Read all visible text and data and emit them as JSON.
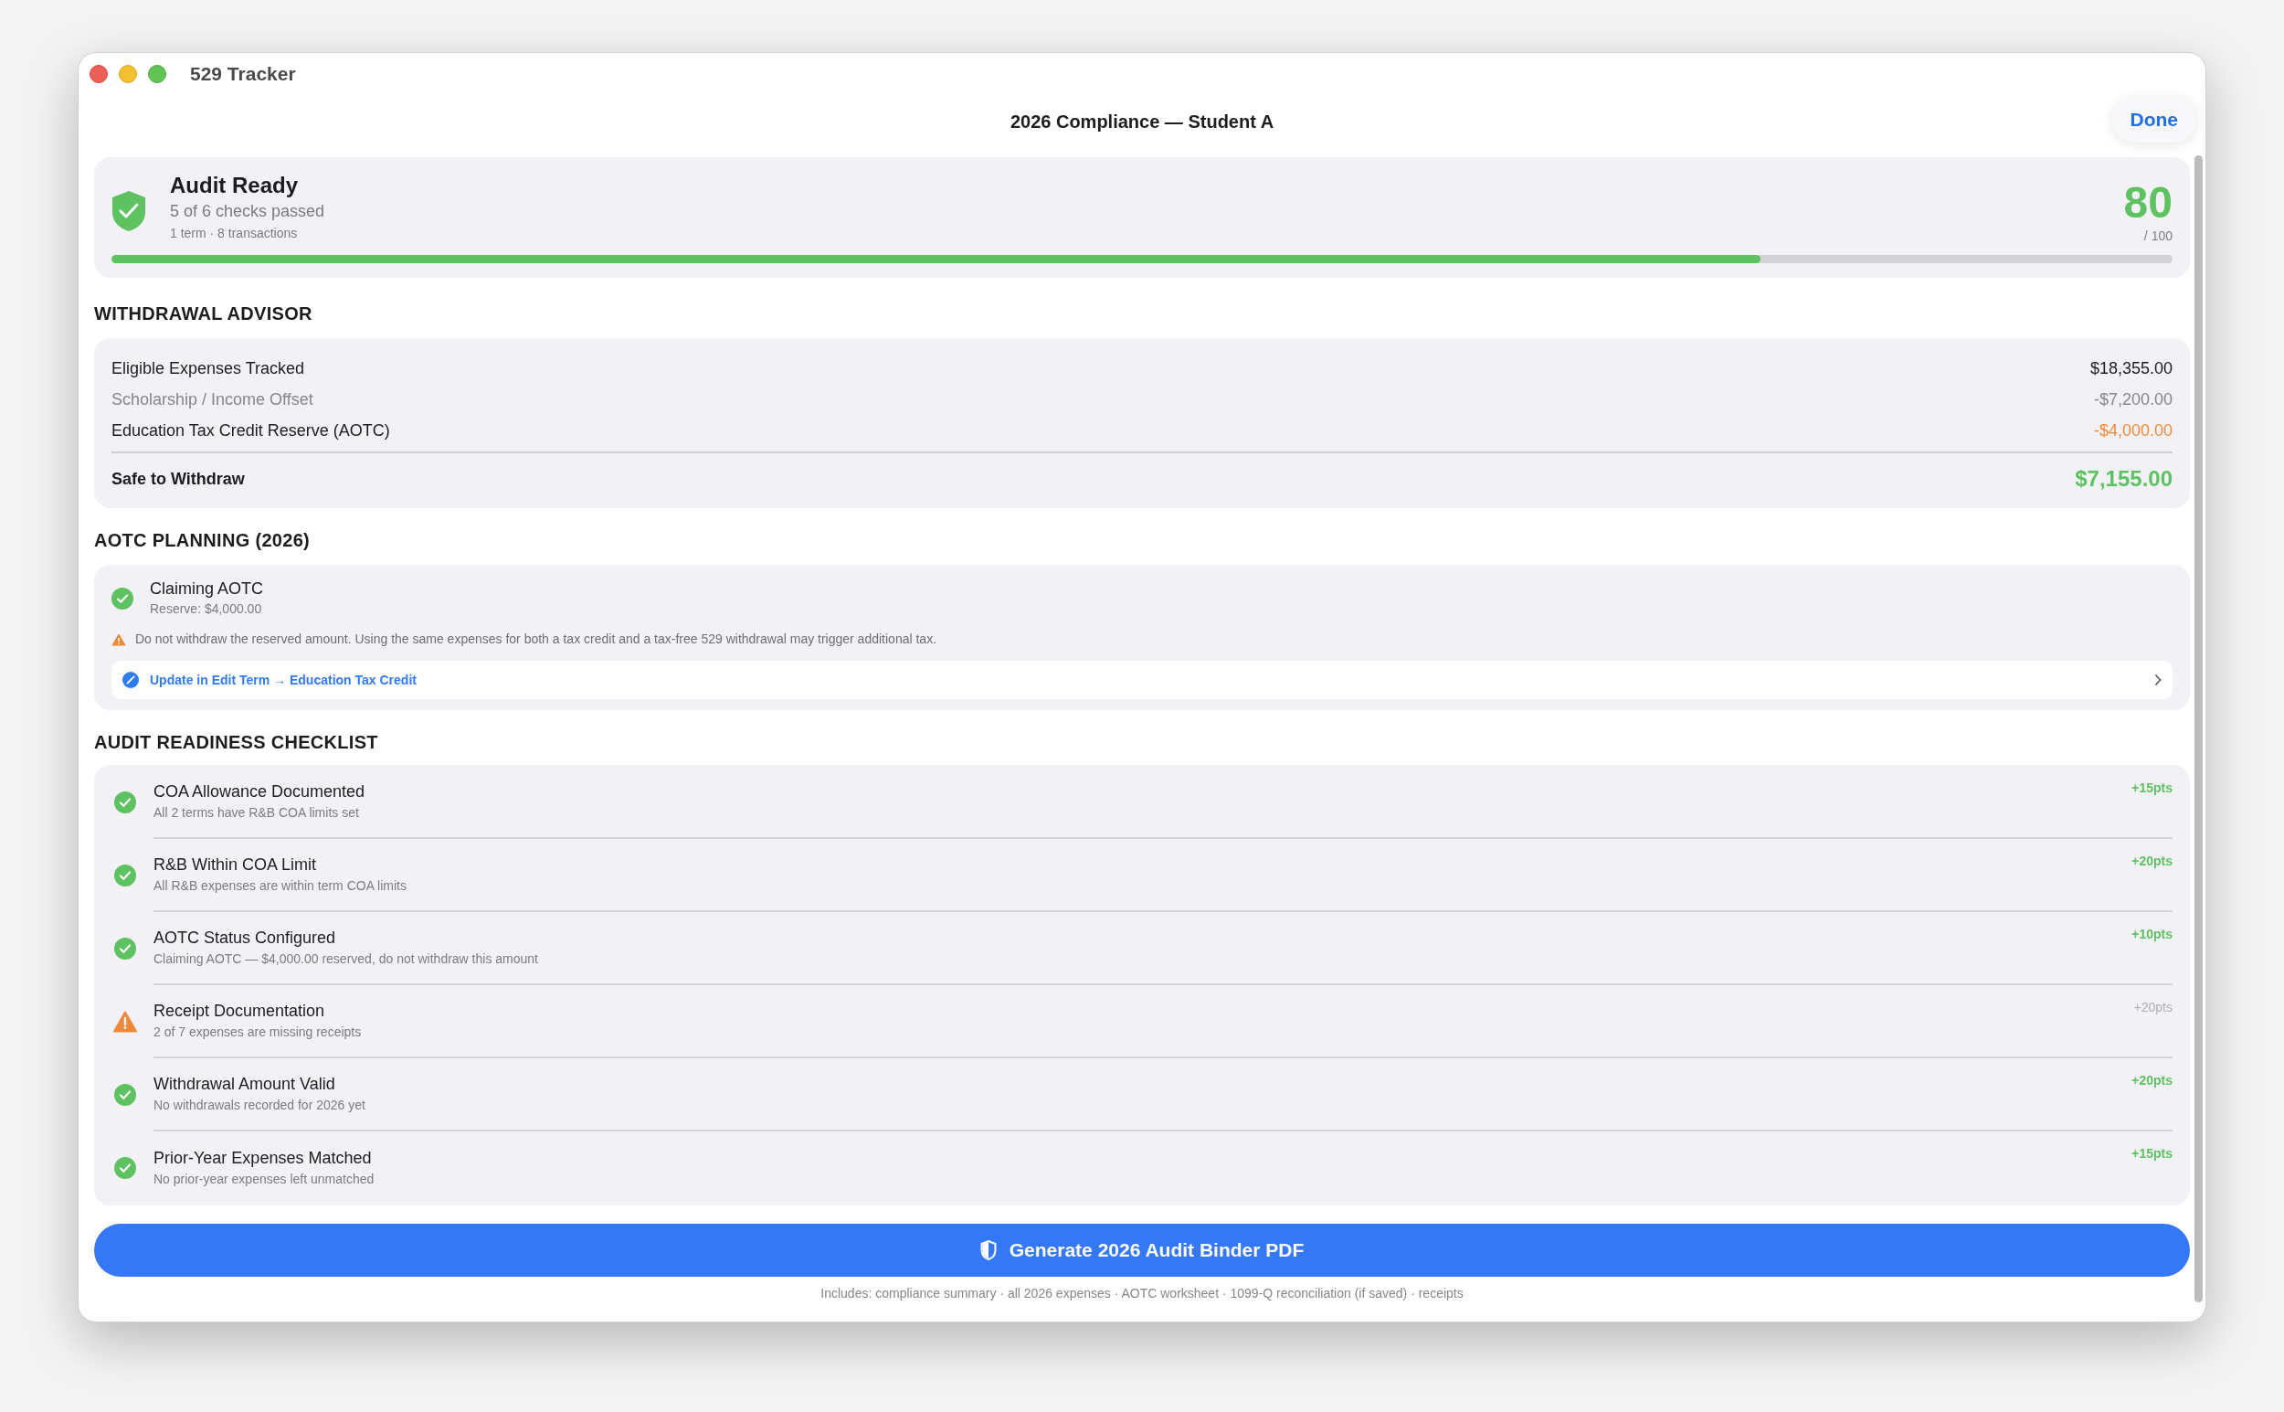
{
  "window": {
    "title": "529 Tracker"
  },
  "header": {
    "title": "2026 Compliance — Student A",
    "done_button": "Done"
  },
  "summary": {
    "title": "Audit Ready",
    "subtitle": "5 of 6 checks passed",
    "detail": "1 term · 8 transactions",
    "score": "80",
    "score_max": "/ 100",
    "level": 0.8
  },
  "withdrawal_advisor": {
    "heading": "WITHDRAWAL ADVISOR",
    "rows": [
      {
        "label": "Eligible Expenses Tracked",
        "amount": "$18,355.00",
        "kind": "normal"
      },
      {
        "label": "Scholarship / Income Offset",
        "amount": "-$7,200.00",
        "kind": "muted"
      },
      {
        "label": "Education Tax Credit Reserve (AOTC)",
        "amount": "-$4,000.00",
        "kind": "warning"
      }
    ],
    "total": {
      "label": "Safe to Withdraw",
      "amount": "$7,155.00"
    }
  },
  "aotc_planning": {
    "heading": "AOTC PLANNING (2026)",
    "status": "Claiming AOTC",
    "reserve": "Reserve: $4,000.00",
    "warning": "Do not withdraw the reserved amount. Using the same expenses for both a tax credit and a tax-free 529 withdrawal may trigger additional tax.",
    "link": "Update in Edit Term → Education Tax Credit"
  },
  "checklist": {
    "heading": "AUDIT READINESS CHECKLIST",
    "items": [
      {
        "title": "COA Allowance Documented",
        "detail": "All 2 terms have R&B COA limits set",
        "points": "+15pts",
        "kind": "pass"
      },
      {
        "title": "R&B Within COA Limit",
        "detail": "All R&B expenses are within term COA limits",
        "points": "+20pts",
        "kind": "pass"
      },
      {
        "title": "AOTC Status Configured",
        "detail": "Claiming AOTC — $4,000.00 reserved, do not withdraw this amount",
        "points": "+10pts",
        "kind": "pass"
      },
      {
        "title": "Receipt Documentation",
        "detail": "2 of 7 expenses are missing receipts",
        "points": "+20pts",
        "kind": "warn"
      },
      {
        "title": "Withdrawal Amount Valid",
        "detail": "No withdrawals recorded for 2026 yet",
        "points": "+20pts",
        "kind": "pass"
      },
      {
        "title": "Prior-Year Expenses Matched",
        "detail": "No prior-year expenses left unmatched",
        "points": "+15pts",
        "kind": "pass"
      }
    ]
  },
  "generate_button": "Generate 2026 Audit Binder PDF",
  "footnote": "Includes: compliance summary · all 2026 expenses · AOTC worksheet · 1099-Q reconciliation (if saved) · receipts"
}
